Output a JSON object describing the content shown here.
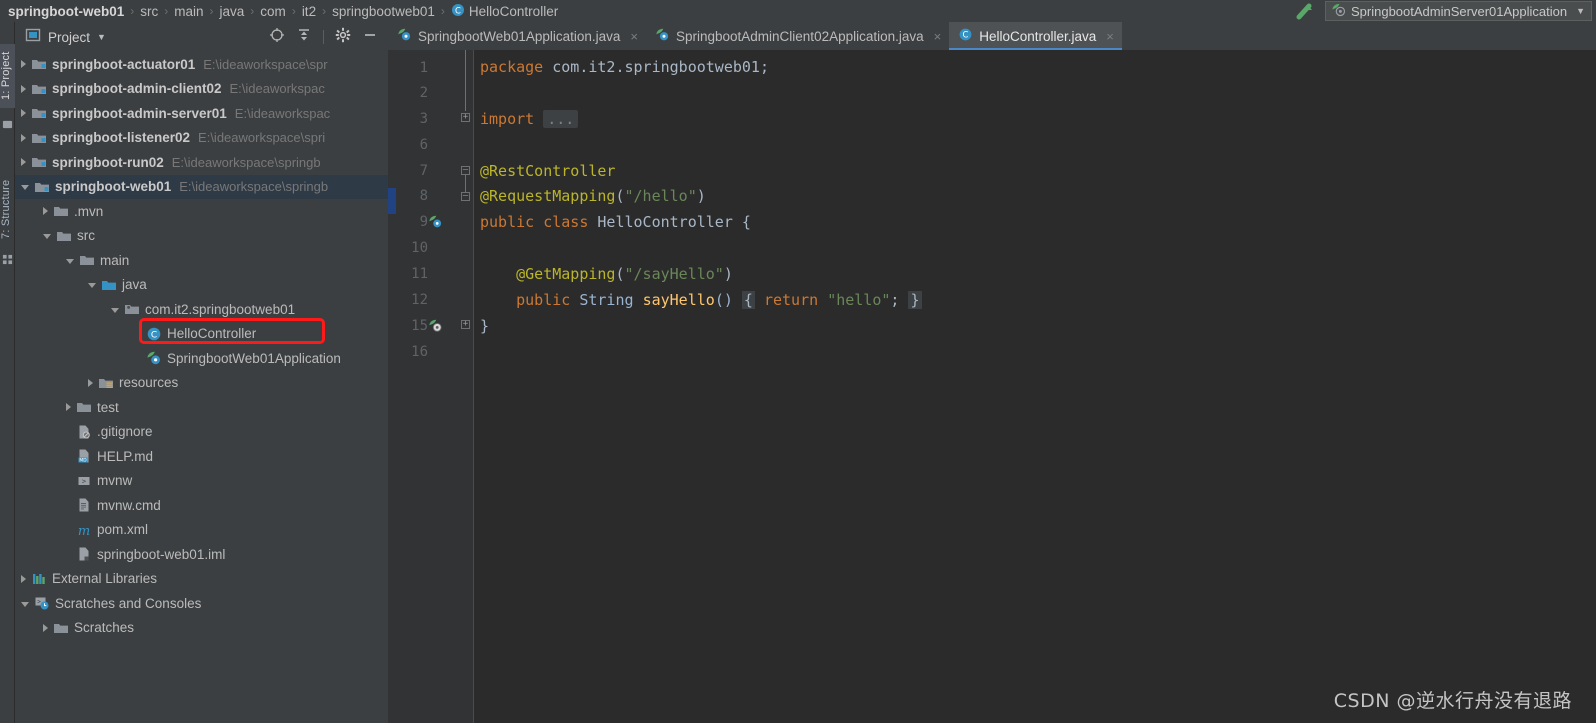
{
  "window": {
    "theme_bg": "#3c3f41",
    "editor_bg": "#2b2b2b",
    "accent": "#4a88c7",
    "annotation_color": "#ff1a1a"
  },
  "breadcrumb": {
    "items": [
      {
        "label": "springboot-web01",
        "icon": "",
        "root": true
      },
      {
        "label": "src",
        "icon": ""
      },
      {
        "label": "main",
        "icon": ""
      },
      {
        "label": "java",
        "icon": ""
      },
      {
        "label": "com",
        "icon": ""
      },
      {
        "label": "it2",
        "icon": ""
      },
      {
        "label": "springbootweb01",
        "icon": ""
      },
      {
        "label": "HelloController",
        "icon": "class-icon"
      }
    ],
    "separator": "›"
  },
  "nav_right": {
    "run_config": "SpringbootAdminServer01Application",
    "run_config_caret": "▼",
    "make_icon": "build-arrow-icon"
  },
  "left_strip": {
    "tabs": [
      {
        "label": "1: Project",
        "active": true
      },
      {
        "label": "7: Structure",
        "active": false
      }
    ]
  },
  "project_panel": {
    "title": "Project",
    "title_caret": "▼",
    "tools": [
      {
        "name": "locate-icon",
        "glyph": "target"
      },
      {
        "name": "collapse-all-icon",
        "glyph": "collapse"
      },
      {
        "name": "gear-icon",
        "glyph": "gear"
      },
      {
        "name": "hide-icon",
        "glyph": "minus"
      }
    ],
    "tree": [
      {
        "label": "springboot-actuator01",
        "path": "E:\\ideaworkspace\\spr",
        "icon": "module-folder-icon",
        "depth": 0,
        "state": "collapsed",
        "bold": true
      },
      {
        "label": "springboot-admin-client02",
        "path": "E:\\ideaworkspac",
        "icon": "module-folder-icon",
        "depth": 0,
        "state": "collapsed",
        "bold": true
      },
      {
        "label": "springboot-admin-server01",
        "path": "E:\\ideaworkspac",
        "icon": "module-folder-icon",
        "depth": 0,
        "state": "collapsed",
        "bold": true
      },
      {
        "label": "springboot-listener02",
        "path": "E:\\ideaworkspace\\spri",
        "icon": "module-folder-icon",
        "depth": 0,
        "state": "collapsed",
        "bold": true
      },
      {
        "label": "springboot-run02",
        "path": "E:\\ideaworkspace\\springb",
        "icon": "module-folder-icon",
        "depth": 0,
        "state": "collapsed",
        "bold": true
      },
      {
        "label": "springboot-web01",
        "path": "E:\\ideaworkspace\\springb",
        "icon": "module-folder-icon",
        "depth": 0,
        "state": "expanded",
        "bold": true,
        "selected": true
      },
      {
        "label": ".mvn",
        "path": "",
        "icon": "folder-icon",
        "depth": 1,
        "state": "collapsed"
      },
      {
        "label": "src",
        "path": "",
        "icon": "folder-icon",
        "depth": 1,
        "state": "expanded"
      },
      {
        "label": "main",
        "path": "",
        "icon": "folder-icon",
        "depth": 2,
        "state": "expanded"
      },
      {
        "label": "java",
        "path": "",
        "icon": "source-folder-icon",
        "depth": 3,
        "state": "expanded"
      },
      {
        "label": "com.it2.springbootweb01",
        "path": "",
        "icon": "package-icon",
        "depth": 4,
        "state": "expanded"
      },
      {
        "label": "HelloController",
        "path": "",
        "icon": "class-icon",
        "depth": 5,
        "state": "leaf",
        "annotated": true
      },
      {
        "label": "SpringbootWeb01Application",
        "path": "",
        "icon": "spring-class-icon",
        "depth": 5,
        "state": "leaf"
      },
      {
        "label": "resources",
        "path": "",
        "icon": "resources-folder-icon",
        "depth": 3,
        "state": "collapsed"
      },
      {
        "label": "test",
        "path": "",
        "icon": "folder-icon",
        "depth": 2,
        "state": "collapsed"
      },
      {
        "label": ".gitignore",
        "path": "",
        "icon": "gitignore-file-icon",
        "depth": 2,
        "state": "leaf"
      },
      {
        "label": "HELP.md",
        "path": "",
        "icon": "markdown-file-icon",
        "depth": 2,
        "state": "leaf"
      },
      {
        "label": "mvnw",
        "path": "",
        "icon": "shell-file-icon",
        "depth": 2,
        "state": "leaf"
      },
      {
        "label": "mvnw.cmd",
        "path": "",
        "icon": "cmd-file-icon",
        "depth": 2,
        "state": "leaf"
      },
      {
        "label": "pom.xml",
        "path": "",
        "icon": "maven-file-icon",
        "depth": 2,
        "state": "leaf"
      },
      {
        "label": "springboot-web01.iml",
        "path": "",
        "icon": "iml-file-icon",
        "depth": 2,
        "state": "leaf"
      },
      {
        "label": "External Libraries",
        "path": "",
        "icon": "libraries-icon",
        "depth": 0,
        "state": "collapsed"
      },
      {
        "label": "Scratches and Consoles",
        "path": "",
        "icon": "scratches-icon",
        "depth": 0,
        "state": "expanded"
      },
      {
        "label": "Scratches",
        "path": "",
        "icon": "folder-icon",
        "depth": 1,
        "state": "collapsed"
      }
    ]
  },
  "editor": {
    "tabs": [
      {
        "label": "SpringbootWeb01Application.java",
        "icon": "spring-class-icon",
        "active": false,
        "close": "×"
      },
      {
        "label": "SpringbootAdminClient02Application.java",
        "icon": "spring-class-icon",
        "active": false,
        "close": "×"
      },
      {
        "label": "HelloController.java",
        "icon": "class-icon",
        "active": true,
        "close": "×"
      }
    ],
    "line_numbers": [
      "1",
      "2",
      "3",
      "6",
      "7",
      "8",
      "9",
      "10",
      "11",
      "12",
      "15",
      "16"
    ],
    "gutter_icons": [
      {
        "line": "9",
        "name": "spring-bean-gutter-icon"
      },
      {
        "line": "12",
        "name": "spring-mapping-gutter-icon"
      }
    ],
    "code_lines": [
      {
        "line": "1",
        "text": "package com.it2.springbootweb01;"
      },
      {
        "line": "2",
        "text": ""
      },
      {
        "line": "3",
        "text": "import ..."
      },
      {
        "line": "6",
        "text": ""
      },
      {
        "line": "7",
        "text": "@RestController"
      },
      {
        "line": "8",
        "text": "@RequestMapping(\"/hello\")"
      },
      {
        "line": "9",
        "text": "public class HelloController {"
      },
      {
        "line": "10",
        "text": ""
      },
      {
        "line": "11",
        "text": "    @GetMapping(\"/sayHello\")"
      },
      {
        "line": "12",
        "text": "    public String sayHello() { return \"hello\"; }"
      },
      {
        "line": "15",
        "text": "}"
      },
      {
        "line": "16",
        "text": ""
      }
    ],
    "tokens": {
      "kw_package": "package",
      "pkg_name": "com.it2.springbootweb01;",
      "kw_import": "import",
      "fold_placeholder": "...",
      "ann_rest": "@RestController",
      "ann_reqmap": "@RequestMapping",
      "str_hello_path": "\"/hello\"",
      "kw_public": "public",
      "kw_class": "class",
      "class_name": "HelloController",
      "brace_open": "{",
      "ann_getmap": "@GetMapping",
      "str_sayhello_path": "\"/sayHello\"",
      "type_string": "String",
      "method_name": "sayHello",
      "parens": "()",
      "kw_return": "return",
      "str_hello": "\"hello\"",
      "semicolon": ";",
      "brace_close": "}"
    },
    "syntax_colors": {
      "keyword": "#cc7832",
      "annotation": "#bbb529",
      "string": "#6a8759",
      "method": "#ffc66d",
      "default": "#a9b7c6",
      "line_number": "#606366"
    }
  },
  "watermark": {
    "text": "CSDN @逆水行舟没有退路"
  }
}
